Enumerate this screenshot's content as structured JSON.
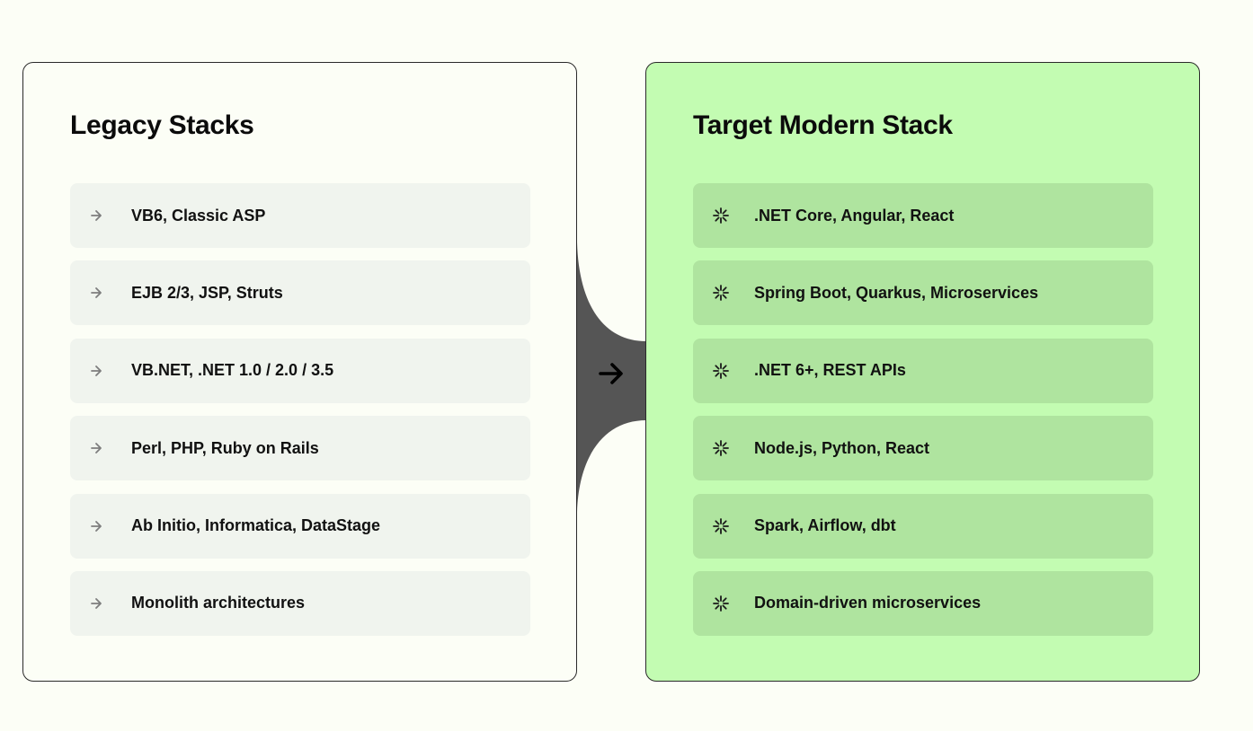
{
  "legacy": {
    "title": "Legacy Stacks",
    "items": [
      {
        "label": "VB6, Classic ASP",
        "icon": "chevron-right-icon"
      },
      {
        "label": "EJB 2/3, JSP, Struts",
        "icon": "chevron-right-icon"
      },
      {
        "label": "VB.NET, .NET 1.0 / 2.0 / 3.5",
        "icon": "chevron-right-icon"
      },
      {
        "label": "Perl, PHP, Ruby on Rails",
        "icon": "chevron-right-icon"
      },
      {
        "label": "Ab Initio, Informatica, DataStage",
        "icon": "chevron-right-icon"
      },
      {
        "label": "Monolith architectures",
        "icon": "chevron-right-icon"
      }
    ]
  },
  "modern": {
    "title": "Target Modern Stack",
    "items": [
      {
        "label": ".NET Core, Angular, React",
        "icon": "sparkle-icon"
      },
      {
        "label": "Spring Boot, Quarkus, Microservices",
        "icon": "sparkle-icon"
      },
      {
        "label": ".NET 6+, REST APIs",
        "icon": "sparkle-icon"
      },
      {
        "label": "Node.js, Python, React",
        "icon": "sparkle-icon"
      },
      {
        "label": "Spark, Airflow, dbt",
        "icon": "sparkle-icon"
      },
      {
        "label": "Domain-driven microservices",
        "icon": "sparkle-icon"
      }
    ]
  },
  "connector": {
    "icon": "arrow-right-icon"
  },
  "colors": {
    "background": "#fcfef6",
    "legacy_panel": "#fcfef6",
    "legacy_item": "#f0f4ee",
    "modern_panel": "#c3fcb2",
    "modern_item": "#afe49f",
    "connector": "#555555"
  }
}
